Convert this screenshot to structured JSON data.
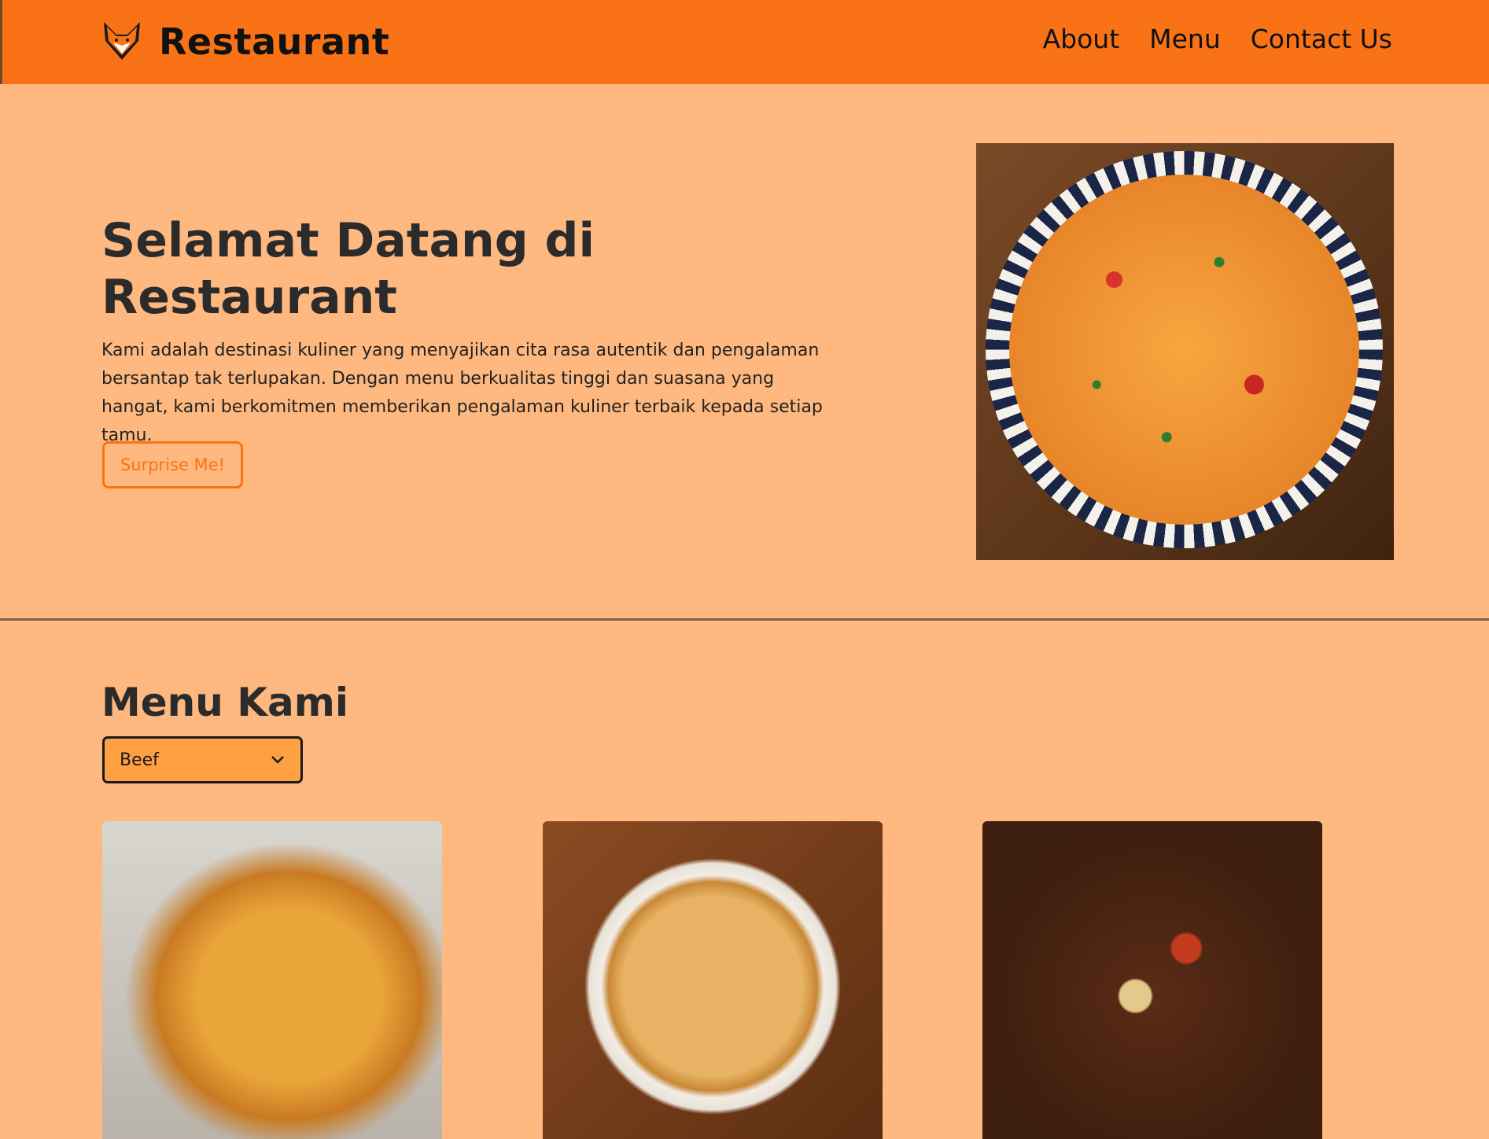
{
  "header": {
    "brand_name": "Restaurant",
    "nav_items": [
      "About",
      "Menu",
      "Contact Us"
    ],
    "background_color": "#f97316"
  },
  "hero": {
    "title": "Selamat Datang di Restaurant",
    "description": "Kami adalah destinasi kuliner yang menyajikan cita rasa autentik dan pengalaman bersantap tak terlupakan. Dengan menu berkualitas tinggi dan suasana yang hangat, kami berkomitmen memberikan pengalaman kuliner terbaik kepada setiap tamu.",
    "cta_label": "Surprise Me!",
    "image": "pasta-dish-image"
  },
  "menu": {
    "title": "Menu Kami",
    "category_select": {
      "selected": "Beef"
    },
    "cards": [
      {
        "image": "beef-pie-image"
      },
      {
        "image": "steak-pie-image"
      },
      {
        "image": "beef-stew-image"
      }
    ]
  },
  "colors": {
    "page_background": "#ffb87f",
    "accent": "#f97316",
    "select_background": "#ffa042"
  }
}
